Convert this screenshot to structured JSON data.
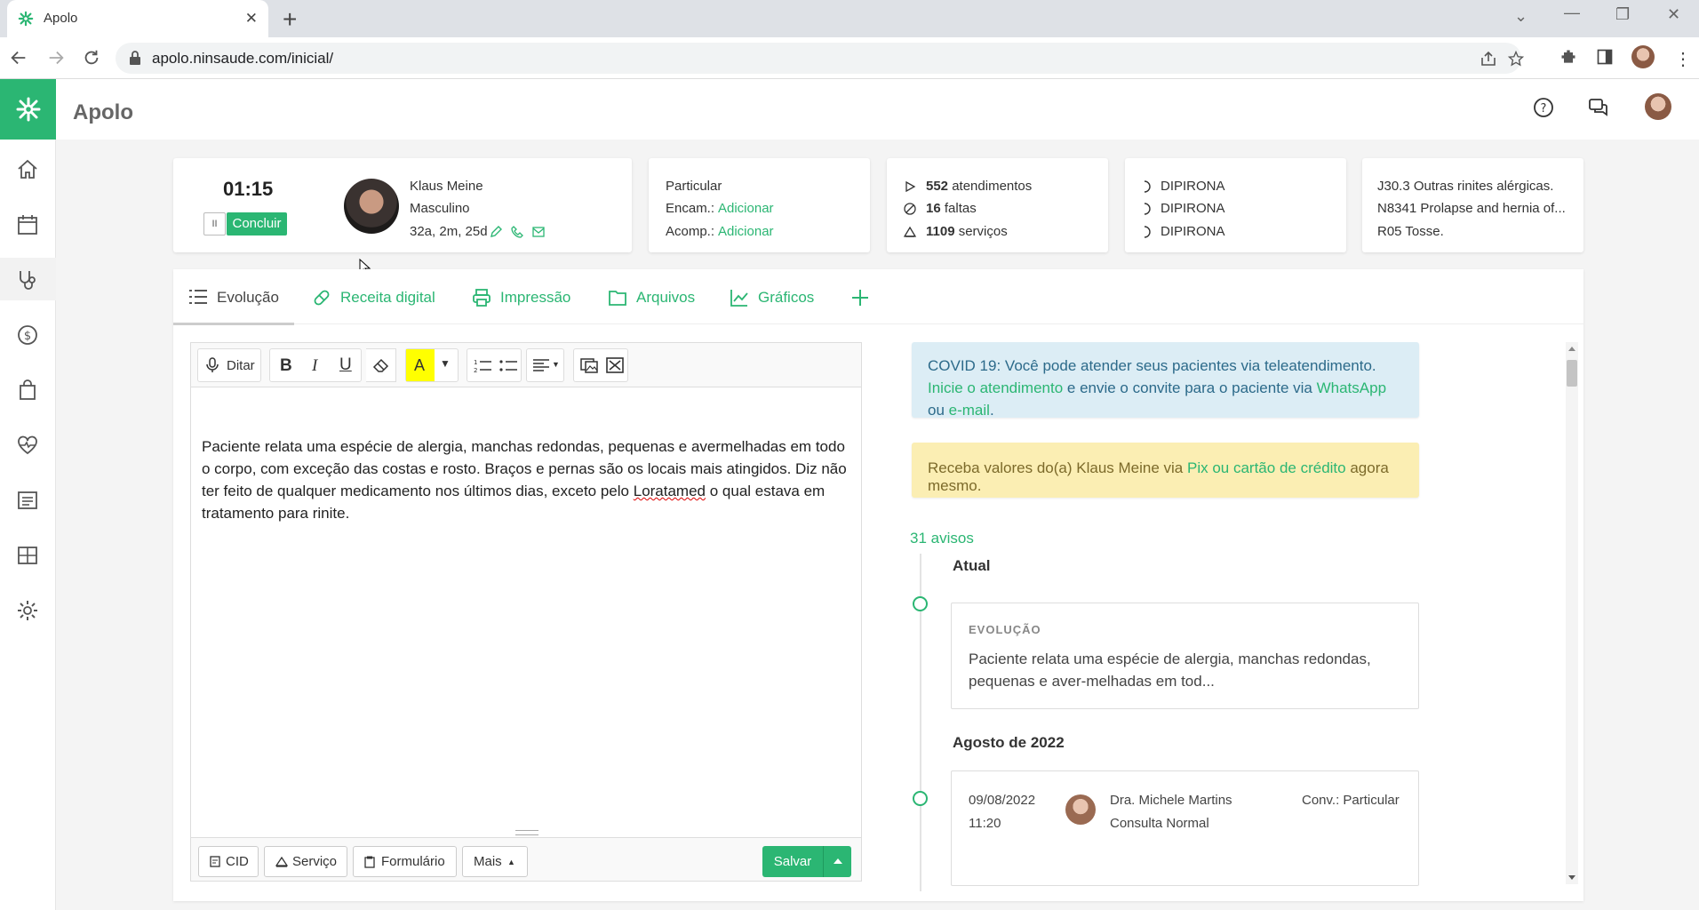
{
  "browser": {
    "tab_title": "Apolo",
    "url": "apolo.ninsaude.com/inicial/"
  },
  "app": {
    "title": "Apolo",
    "accent": "#2bb673"
  },
  "sidebar": {
    "items": [
      "home-icon",
      "calendar-icon",
      "stethoscope-icon",
      "dollar-icon",
      "bag-icon",
      "heartbeat-icon",
      "report-icon",
      "grid-icon",
      "gear-icon"
    ],
    "active_index": 2
  },
  "timer_card": {
    "time": "01:15",
    "pause_label": "II",
    "conclude_label": "Concluir",
    "patient_name": "Klaus Meine",
    "gender": "Masculino",
    "age": "32a, 2m, 25d"
  },
  "insurance_card": {
    "plan": "Particular",
    "encam_label": "Encam.:",
    "encam_action": "Adicionar",
    "acomp_label": "Acomp.:",
    "acomp_action": "Adicionar"
  },
  "stats_card": {
    "appointments_count": "552",
    "appointments_label": "atendimentos",
    "absences_count": "16",
    "absences_label": "faltas",
    "services_count": "1109",
    "services_label": "serviços"
  },
  "allergy_card": {
    "items": [
      "DIPIRONA",
      "DIPIRONA",
      "DIPIRONA"
    ]
  },
  "cid_card": {
    "items": [
      "J30.3 Outras rinites alérgicas.",
      "N8341 Prolapse and hernia of...",
      "R05 Tosse."
    ]
  },
  "tabs": [
    {
      "label": "Evolução"
    },
    {
      "label": "Receita digital"
    },
    {
      "label": "Impressão"
    },
    {
      "label": "Arquivos"
    },
    {
      "label": "Gráficos"
    }
  ],
  "editor": {
    "dictate_label": "Ditar",
    "text_before": "Paciente relata uma espécie de alergia, manchas redondas, pequenas e avermelhadas em todo o corpo, com exceção das costas e rosto. Braços e pernas são os locais mais atingidos. Diz não ter feito de qualquer medicamento nos últimos dias, exceto pelo ",
    "text_misspelled": "Loratamed",
    "text_after": " o qual estava em tratamento para rinite.",
    "btn_cid": "CID",
    "btn_servico": "Serviço",
    "btn_formulario": "Formulário",
    "btn_mais": "Mais",
    "btn_salvar": "Salvar"
  },
  "alerts": {
    "covid_prefix": "COVID 19: Você pode atender seus pacientes via teleatendimento.",
    "covid_link1": "Inicie o atendimento",
    "covid_mid": "e envie o convite para o paciente via",
    "covid_link2": "WhatsApp",
    "covid_or": "ou",
    "covid_link3": "e-mail",
    "covid_end": ".",
    "pix_prefix": "Receba valores do(a) Klaus Meine via",
    "pix_link": "Pix ou cartão de crédito",
    "pix_suffix": "agora mesmo."
  },
  "timeline": {
    "notices": "31 avisos",
    "current_heading": "Atual",
    "evolution_label": "EVOLUÇÃO",
    "evolution_text": "Paciente relata uma espécie de alergia, manchas redondas, pequenas e aver-melhadas em tod...",
    "month_heading": "Agosto de 2022",
    "visit_date": "09/08/2022",
    "visit_time": "11:20",
    "doctor": "Dra. Michele Martins",
    "visit_type": "Consulta Normal",
    "conv": "Conv.: Particular"
  }
}
